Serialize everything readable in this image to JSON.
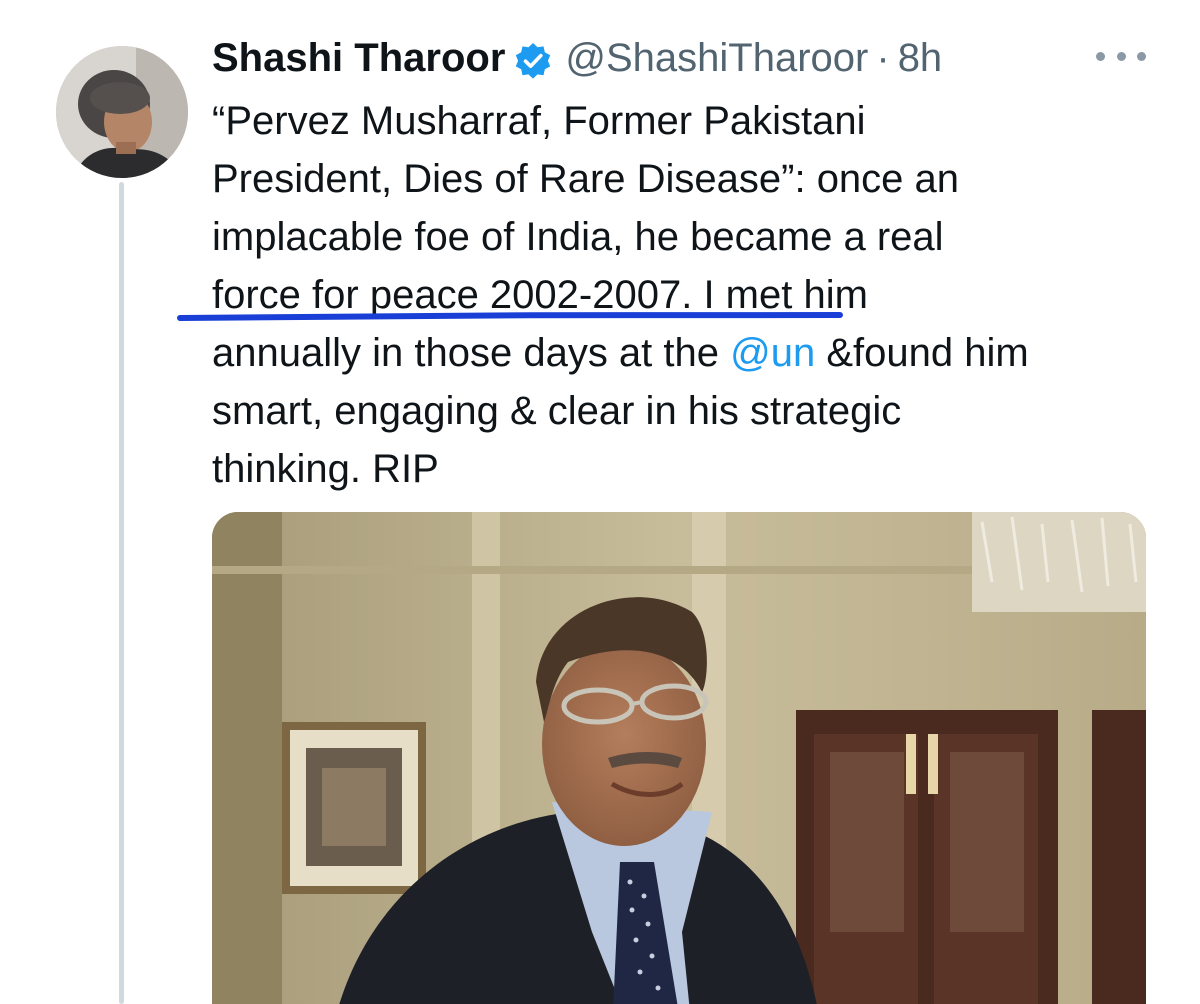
{
  "author": {
    "display_name": "Shashi Tharoor",
    "handle": "@ShashiTharoor",
    "separator": "·",
    "time": "8h",
    "verified": true
  },
  "tweet": {
    "lines": [
      [
        "“Pervez Musharraf, Former Pakistani"
      ],
      [
        "President, Dies of Rare Disease”: once an"
      ],
      [
        "implacable foe of India, he became a real"
      ],
      [
        "force for peace 2002-2007. I met him"
      ],
      [
        "annually in those days at the ",
        "@un",
        " &found him"
      ],
      [
        "smart, engaging & clear in his strategic"
      ],
      [
        "thinking. RIP"
      ]
    ]
  },
  "mention": {
    "text": "@un"
  },
  "icons": {
    "verified": "verified-badge-icon",
    "more": "more-options-icon"
  },
  "colors": {
    "text": "#0f1419",
    "secondary": "#536471",
    "link": "#1d9bf0",
    "verified": "#1d9bf0",
    "annotation_underline": "#1a3fd6",
    "thread_line": "#cfd9de"
  }
}
